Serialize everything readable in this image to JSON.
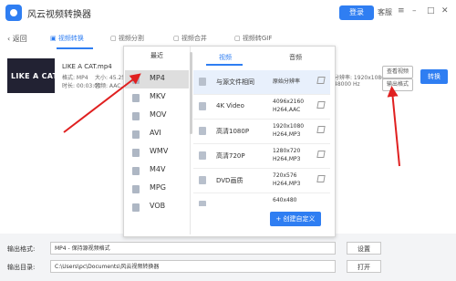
{
  "app": {
    "title": "风云视频转换器",
    "login": "登录",
    "service": "客服"
  },
  "window_icons": [
    "≡",
    "–",
    "□",
    "✕"
  ],
  "nav": {
    "back": "返回",
    "tabs": [
      {
        "label": "视频转换"
      },
      {
        "label": "视频分割"
      },
      {
        "label": "视频合并"
      },
      {
        "label": "视频转GIF"
      }
    ]
  },
  "file": {
    "thumb_text": "LIKE A CAT",
    "name": "LIKE A CAT.mp4",
    "format": "格式: MP4",
    "size": "大小: 45.25",
    "duration": "时长: 00:03:01",
    "audio": "音频: AAC, 44",
    "resolution": "分辨率: 1920x1080",
    "sample_rate": "48000 Hz",
    "view_video": "查看视频",
    "output_format": "输出格式",
    "convert": "转换"
  },
  "popup": {
    "recent": "最近",
    "tabs": [
      "视频",
      "音频"
    ],
    "formats": [
      "MP4",
      "MKV",
      "MOV",
      "AVI",
      "WMV",
      "M4V",
      "MPG",
      "VOB"
    ],
    "presets": [
      {
        "name": "与源文件相同",
        "line1": "原始分辨率",
        "line2": ""
      },
      {
        "name": "4K Video",
        "line1": "4096x2160",
        "line2": "H264,AAC"
      },
      {
        "name": "高清1080P",
        "line1": "1920x1080",
        "line2": "H264,MP3"
      },
      {
        "name": "高清720P",
        "line1": "1280x720",
        "line2": "H264,MP3"
      },
      {
        "name": "DVD画质",
        "line1": "720x576",
        "line2": "H264,MP3"
      },
      {
        "name": "",
        "line1": "640x480",
        "line2": ""
      }
    ],
    "create": "+ 创建自定义"
  },
  "bottom": {
    "format_label": "输出格式:",
    "format_value": "MP4 - 保持源视频格式",
    "settings": "设置",
    "dir_label": "输出目录:",
    "dir_value": "C:\\Users\\pc\\Documents\\风云视频转换器",
    "open": "打开"
  },
  "colors": {
    "accent": "#2f7ef2",
    "arrow": "#e02020"
  }
}
